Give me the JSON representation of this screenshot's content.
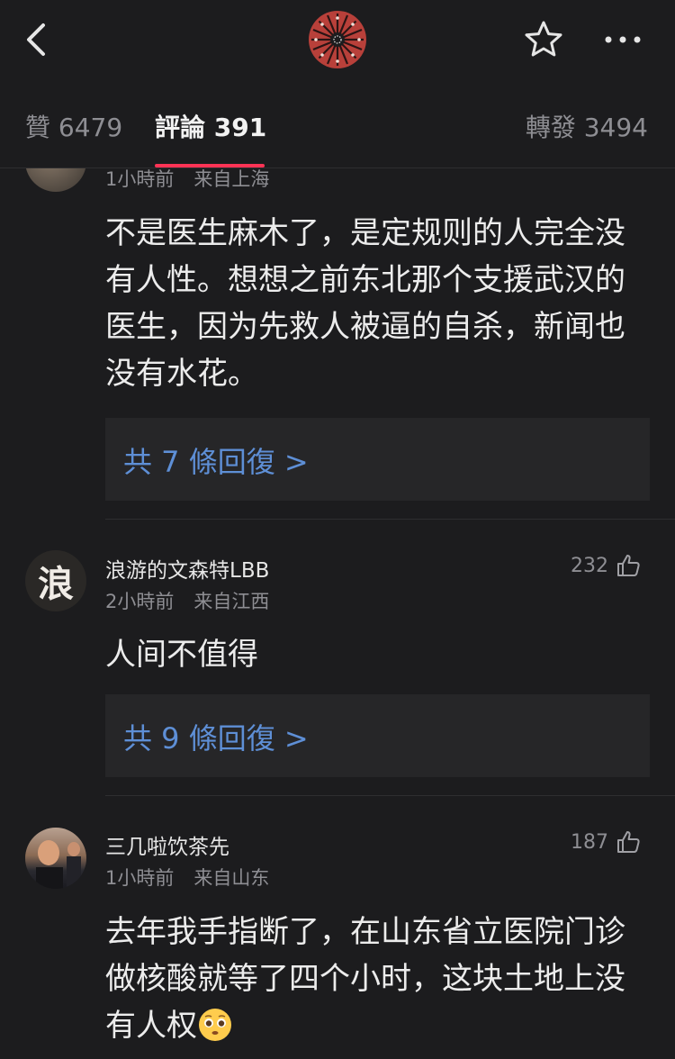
{
  "tabs": {
    "likes": "贊 6479",
    "comments": "評論 391",
    "reposts": "轉發 3494"
  },
  "comments": [
    {
      "meta_time": "1小時前",
      "meta_location": "来自上海",
      "text": "不是医生麻木了，是定规则的人完全没有人性。想想之前东北那个支援武汉的医生，因为先救人被逼的自杀，新闻也没有水花。",
      "replies": "共 7 條回復 >"
    },
    {
      "username": "浪游的文森特LBB",
      "avatar_char": "浪",
      "meta_time": "2小時前",
      "meta_location": "来自江西",
      "likes": "232",
      "text": "人间不值得",
      "replies": "共 9 條回復 >"
    },
    {
      "username": "三几啦饮茶先",
      "meta_time": "1小時前",
      "meta_location": "来自山东",
      "likes": "187",
      "text": "去年我手指断了，在山东省立医院门诊做核酸就等了四个小时，这块土地上没有人权"
    }
  ]
}
